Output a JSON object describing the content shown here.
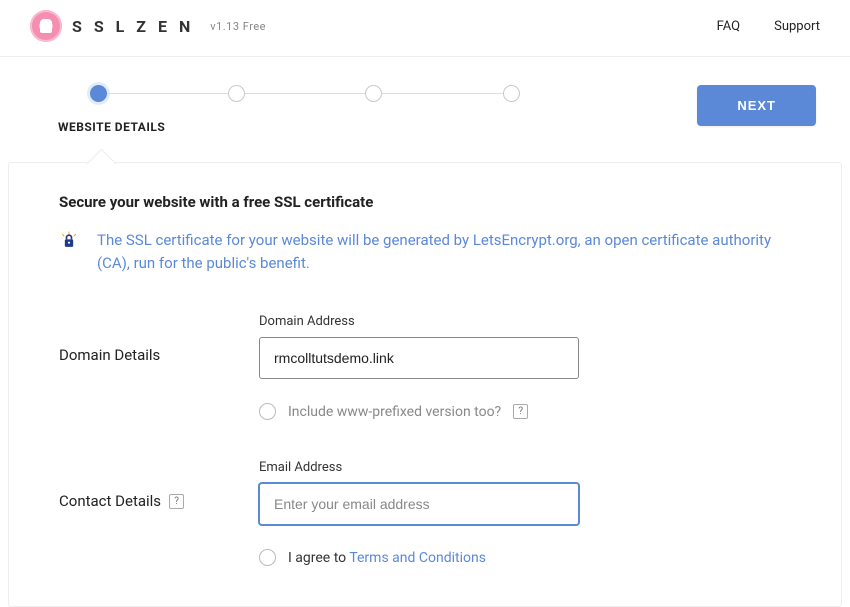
{
  "header": {
    "brand_text": "S S L Z E N",
    "version": "v1.13 Free",
    "nav": {
      "faq": "FAQ",
      "support": "Support"
    }
  },
  "wizard": {
    "step1_label": "WEBSITE DETAILS",
    "next_button": "NEXT"
  },
  "panel": {
    "title": "Secure your website with a free SSL certificate",
    "intro": "The SSL certificate for your website will be generated by LetsEncrypt.org, an open certificate authority (CA), run for the public's benefit."
  },
  "domain_section": {
    "section_label": "Domain Details",
    "field_label": "Domain Address",
    "value": "rmcolltutsdemo.link",
    "www_checkbox_label": "Include www-prefixed version too?"
  },
  "contact_section": {
    "section_label": "Contact Details",
    "field_label": "Email Address",
    "placeholder": "Enter your email address",
    "value": "",
    "agree_prefix": "I agree to ",
    "terms_link": "Terms and Conditions"
  },
  "colors": {
    "accent": "#5b89d8"
  }
}
